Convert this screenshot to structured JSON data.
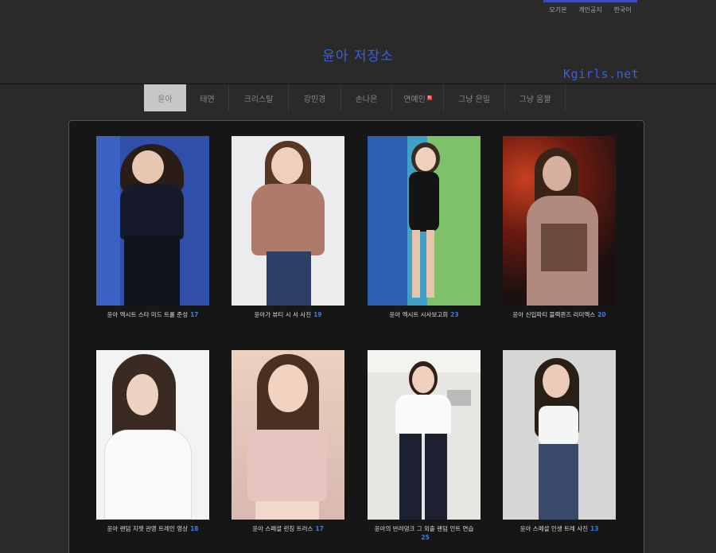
{
  "top_links": [
    "모기본",
    "개인공지",
    "한국어"
  ],
  "site": {
    "title": "윤아 저장소",
    "brand": "Kgirls.net"
  },
  "nav": [
    {
      "label": "윤아",
      "active": true
    },
    {
      "label": "태연"
    },
    {
      "label": "크리스탈"
    },
    {
      "label": "강민경"
    },
    {
      "label": "손나은"
    },
    {
      "label": "연예인",
      "badge": "N"
    },
    {
      "label": "그냥 은밀"
    },
    {
      "label": "그냥 움짤"
    }
  ],
  "cards": [
    {
      "caption": "윤아 엑시트 스타 미드 트롤 준성",
      "count": "17",
      "bg": "#2f4fa8",
      "accent": "#1a1a2a"
    },
    {
      "caption": "윤아가 뷰티 시 서 사진",
      "count": "19",
      "bg": "#ececee",
      "accent": "#a56a5a"
    },
    {
      "caption": "윤아 엑시트 시사보고회",
      "count": "23",
      "bg": "#3fa0c8",
      "accent": "#1a1a1a"
    },
    {
      "caption": "윤아 신입파티 블랙퀸즈 리미엑스",
      "count": "20",
      "bg": "#2a1a18",
      "accent": "#9a6a55"
    },
    {
      "caption": "윤아 랜덤 지젯 관영 트레인 영상",
      "count": "18",
      "bg": "#f2f2f2",
      "accent": "#3a2a22"
    },
    {
      "caption": "윤아 스페셜 런칭 트러스",
      "count": "17",
      "bg": "#e2c8b8",
      "accent": "#c89a8a"
    },
    {
      "caption": "윤아의 반려댕크 그 외출 랜덤 인트 연습",
      "count": "25",
      "bg": "#ece9e4",
      "accent": "#2a2a3a"
    },
    {
      "caption": "윤아 스페셜 인생 트레 사진",
      "count": "13",
      "bg": "#d8d8d8",
      "accent": "#3a4a66"
    }
  ]
}
